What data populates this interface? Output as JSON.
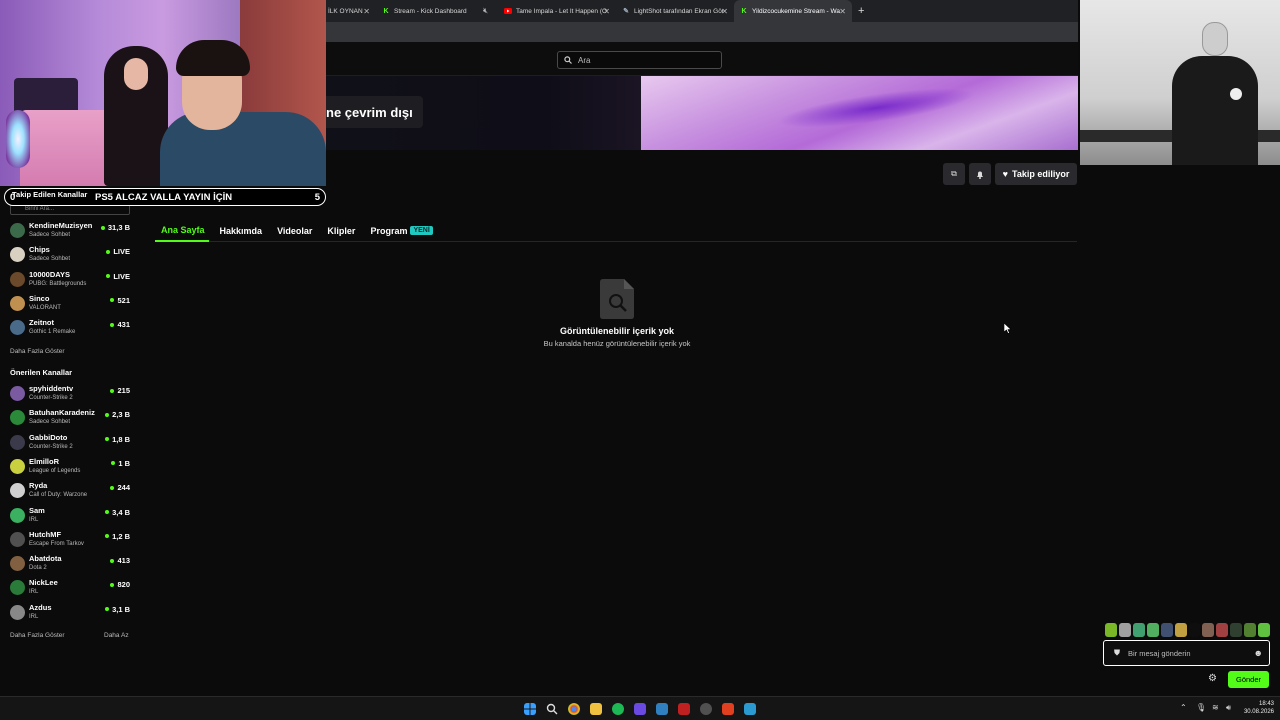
{
  "browser": {
    "tabs": [
      {
        "label": "İLK OYNAN",
        "icon": "",
        "active": false
      },
      {
        "label": "Stream - Kick Dashboard",
        "icon": "K",
        "active": false
      },
      {
        "label": "",
        "icon": "mute",
        "active": false
      },
      {
        "label": "Tame Impala - Let It Happen (O",
        "icon": "yt",
        "active": false
      },
      {
        "label": "LightShot tarafından Ekran Gör",
        "icon": "pen",
        "active": false
      },
      {
        "label": "Yildizcocukemine Stream - Wa",
        "icon": "K",
        "active": true
      }
    ],
    "new_tab": "+"
  },
  "header": {
    "search_placeholder": "Ara"
  },
  "banner": {
    "offline_text": "ne çevrim dışı"
  },
  "actions": {
    "follow_label": "Takip ediliyor"
  },
  "channel_tabs": [
    {
      "label": "Ana Sayfa",
      "active": true
    },
    {
      "label": "Hakkımda"
    },
    {
      "label": "Videolar"
    },
    {
      "label": "Klipler"
    },
    {
      "label": "Program",
      "badge": "YENİ"
    }
  ],
  "empty_state": {
    "title": "Görüntülenebilir içerik yok",
    "subtitle": "Bu kanalda henüz görüntülenebilir içerik yok"
  },
  "overlay": {
    "left": "0",
    "title": "PS5 ALCAZ VALLA YAYIN İÇİN",
    "right": "5"
  },
  "sidebar": {
    "followed_heading": "Takip Edilen Kanallar",
    "search_placeholder": "Birini Ara...",
    "followed": [
      {
        "name": "KendineMuzisyen",
        "game": "Sadece Sohbet",
        "viewers": "31,3 B",
        "color": "#3a6a4a"
      },
      {
        "name": "Chips",
        "game": "Sadece Sohbet",
        "viewers": "LIVE",
        "color": "#d8d0c0"
      },
      {
        "name": "10000DAYS",
        "game": "PUBG: Battlegrounds",
        "viewers": "LIVE",
        "color": "#6a4a2a"
      },
      {
        "name": "Sinco",
        "game": "VALORANT",
        "viewers": "521",
        "color": "#c09050"
      },
      {
        "name": "Zeitnot",
        "game": "Gothic 1 Remake",
        "viewers": "431",
        "color": "#4a6a8a"
      }
    ],
    "show_more_1": "Daha Fazla Göster",
    "recommended_heading": "Önerilen Kanallar",
    "recommended": [
      {
        "name": "spyhiddentv",
        "game": "Counter-Strike 2",
        "viewers": "215",
        "color": "#7a5aa0"
      },
      {
        "name": "BatuhanKaradeniz",
        "game": "Sadece Sohbet",
        "viewers": "2,3 B",
        "color": "#2a8a3a"
      },
      {
        "name": "GabbiDoto",
        "game": "Counter-Strike 2",
        "viewers": "1,8 B",
        "color": "#3a3a4a"
      },
      {
        "name": "ElmilloR",
        "game": "League of Legends",
        "viewers": "1 B",
        "color": "#c8d040"
      },
      {
        "name": "Ryda",
        "game": "Call of Duty: Warzone",
        "viewers": "244",
        "color": "#d0d0d0"
      },
      {
        "name": "Sam",
        "game": "IRL",
        "viewers": "3,4 B",
        "color": "#3ab060"
      },
      {
        "name": "HutchMF",
        "game": "Escape From Tarkov",
        "viewers": "1,2 B",
        "color": "#505050"
      },
      {
        "name": "Abatdota",
        "game": "Dota 2",
        "viewers": "413",
        "color": "#806040"
      },
      {
        "name": "NickLee",
        "game": "IRL",
        "viewers": "820",
        "color": "#2a7a3a"
      },
      {
        "name": "Azdus",
        "game": "IRL",
        "viewers": "3,1 B",
        "color": "#888888"
      }
    ],
    "show_more_2": "Daha Fazla Göster",
    "show_less": "Daha Az"
  },
  "chat": {
    "placeholder": "Bir mesaj gönderin",
    "send_label": "Gönder"
  },
  "taskbar": {
    "time": "18:43",
    "date": "30.08.2026"
  },
  "colors": {
    "accent": "#53fc18",
    "new_badge": "#20c9c0"
  }
}
